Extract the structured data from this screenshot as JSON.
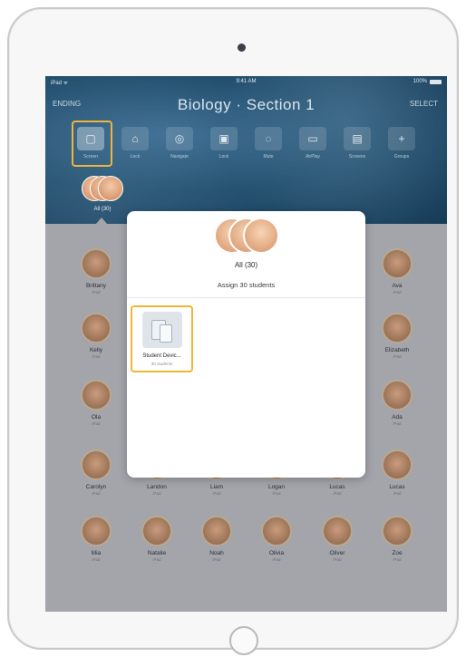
{
  "status_bar": {
    "carrier": "iPad ᯤ",
    "time": "9:41 AM",
    "battery": "100%"
  },
  "nav": {
    "left": "ENDING",
    "title": "Biology · Section 1",
    "right": "SELECT"
  },
  "toolbar": {
    "items": [
      {
        "label": "Screen",
        "icon": "tablet-icon",
        "glyph": "▢"
      },
      {
        "label": "Lock",
        "icon": "lock-icon",
        "glyph": "⌂"
      },
      {
        "label": "Navigate",
        "icon": "compass-icon",
        "glyph": "◎"
      },
      {
        "label": "Lock",
        "icon": "padlock-icon",
        "glyph": "▣"
      },
      {
        "label": "Mute",
        "icon": "mute-icon",
        "glyph": "◌"
      },
      {
        "label": "AirPlay",
        "icon": "airplay-icon",
        "glyph": "▭"
      },
      {
        "label": "Screens",
        "icon": "screens-icon",
        "glyph": "▤"
      },
      {
        "label": "Groups",
        "icon": "plus-icon",
        "glyph": "+"
      }
    ]
  },
  "group_tab": {
    "label": "All (30)"
  },
  "students": [
    {
      "name": "Brittany",
      "sub": "iPad"
    },
    {
      "name": "Ava",
      "sub": "iPad"
    },
    {
      "name": "Kelly",
      "sub": "iPad"
    },
    {
      "name": "Elizabeth",
      "sub": "iPad"
    },
    {
      "name": "Ola",
      "sub": "iPad"
    },
    {
      "name": "Ada",
      "sub": "iPad"
    },
    {
      "name": "Carolyn",
      "sub": "iPad"
    },
    {
      "name": "Landon",
      "sub": "iPad"
    },
    {
      "name": "Liam",
      "sub": "iPad"
    },
    {
      "name": "Logan",
      "sub": "iPad"
    },
    {
      "name": "Lucas",
      "sub": "iPad"
    },
    {
      "name": "Lucas",
      "sub": "iPad"
    },
    {
      "name": "Mia",
      "sub": "iPad"
    },
    {
      "name": "Natalie",
      "sub": "iPad"
    },
    {
      "name": "Noah",
      "sub": "iPad"
    },
    {
      "name": "Olivia",
      "sub": "iPad"
    },
    {
      "name": "Oliver",
      "sub": "iPad"
    },
    {
      "name": "Zoe",
      "sub": "iPad"
    }
  ],
  "modal": {
    "title": "All (30)",
    "subtitle": "Assign 30 students",
    "device": {
      "label": "Student Devic...",
      "sub": "30 students"
    }
  }
}
